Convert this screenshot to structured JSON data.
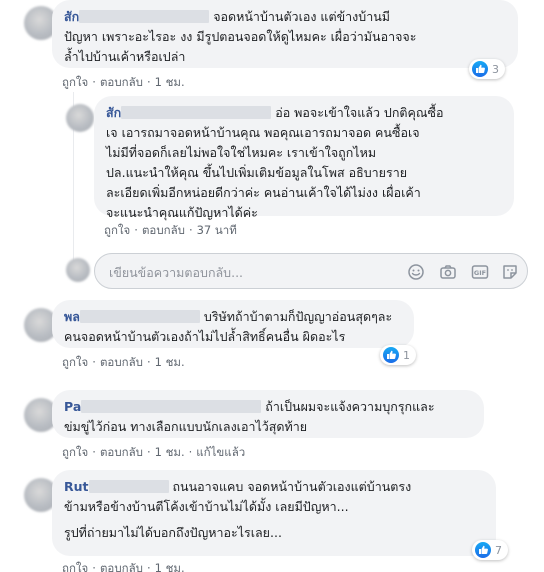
{
  "comments": [
    {
      "name_prefix": "สัก",
      "text": "จอดหน้าบ้านตัวเอง แต่ข้างบ้านมีปัญหา เพราะอะไรอะ งง มีรูปตอนจอดให้ดูไหมคะ เผื่อว่ามันอาจจะล้ำไปบ้านเค้าหรือเปล่า",
      "lines": [
        "จอดหน้าบ้านตัวเอง แต่ข้างบ้านมี",
        "ปัญหา เพราะอะไรอะ งง มีรูปตอนจอดให้ดูไหมคะ เผื่อว่ามันอาจจะ",
        "ล้ำไปบ้านเค้าหรือเปล่า"
      ],
      "like": "ถูกใจ",
      "reply": "ตอบกลับ",
      "time": "1 ชม.",
      "reaction_count": "3"
    },
    {
      "name_prefix": "สัก",
      "lines": [
        "อ่อ พอจะเข้าใจแล้ว ปกติคุณซื้อ",
        "เจ เอารถมาจอดหน้าบ้านคุณ พอคุณเอารถมาจอด คนซื้อเจ",
        "ไม่มีที่จอดก็เลยไม่พอใจใช่ไหมคะ เราเข้าใจถูกไหม",
        "ปล.แนะนำให้คุณ ขึ้นไปเพิ่มเติมข้อมูลในโพส อธิบายราย",
        "ละเอียดเพิ่มอีกหน่อยดีกว่าค่ะ คนอ่านเค้าใจได้ไม่งง เผื่อเค้า",
        "จะแนะนำคุณแก้ปัญหาได้ค่ะ"
      ],
      "like": "ถูกใจ",
      "reply": "ตอบกลับ",
      "time": "37 นาที"
    },
    {
      "name_prefix": "พล",
      "lines": [
        "บริษัทถ้าบ้าตามก็ปัญญาอ่อนสุดๆละ",
        "คนจอดหน้าบ้านตัวเองถ้าไม่ไปล้ำสิทธิ์คนอื่น ผิดอะไร"
      ],
      "like": "ถูกใจ",
      "reply": "ตอบกลับ",
      "time": "1 ชม.",
      "reaction_count": "1"
    },
    {
      "name_prefix": "Pa",
      "lines": [
        "ถ้าเป็นผมจะแจ้งความบุกรุกและ",
        "ข่มขู่ไว้ก่อน ทางเลือกแบบนักเลงเอาไว้สุดท้าย"
      ],
      "like": "ถูกใจ",
      "reply": "ตอบกลับ",
      "time": "1 ชม.",
      "edited": "แก้ไขแล้ว"
    },
    {
      "name_prefix": "Rut",
      "lines": [
        "ถนนอาจแคบ จอดหน้าบ้านตัวเองแต่บ้านตรง",
        "ข้ามหรือข้างบ้านตีโค้งเข้าบ้านไม่ได้มั้ง เลยมีปัญหา...",
        "",
        "รูปที่ถ่ายมาไม่ได้บอกถึงปัญหาอะไรเลย..."
      ],
      "like": "ถูกใจ",
      "reply": "ตอบกลับ",
      "time": "1 ชม.",
      "reaction_count": "7"
    }
  ],
  "reply_box": {
    "placeholder": "เขียนข้อความตอบกลับ..."
  },
  "icons": {
    "emoji": "smiley-icon",
    "camera": "camera-icon",
    "gif": "gif-icon",
    "sticker": "sticker-icon",
    "like": "thumbs-up-icon"
  },
  "colors": {
    "name": "#385898",
    "bubble": "#f2f3f5",
    "meta": "#606770",
    "like_blue": "#1877f2"
  }
}
